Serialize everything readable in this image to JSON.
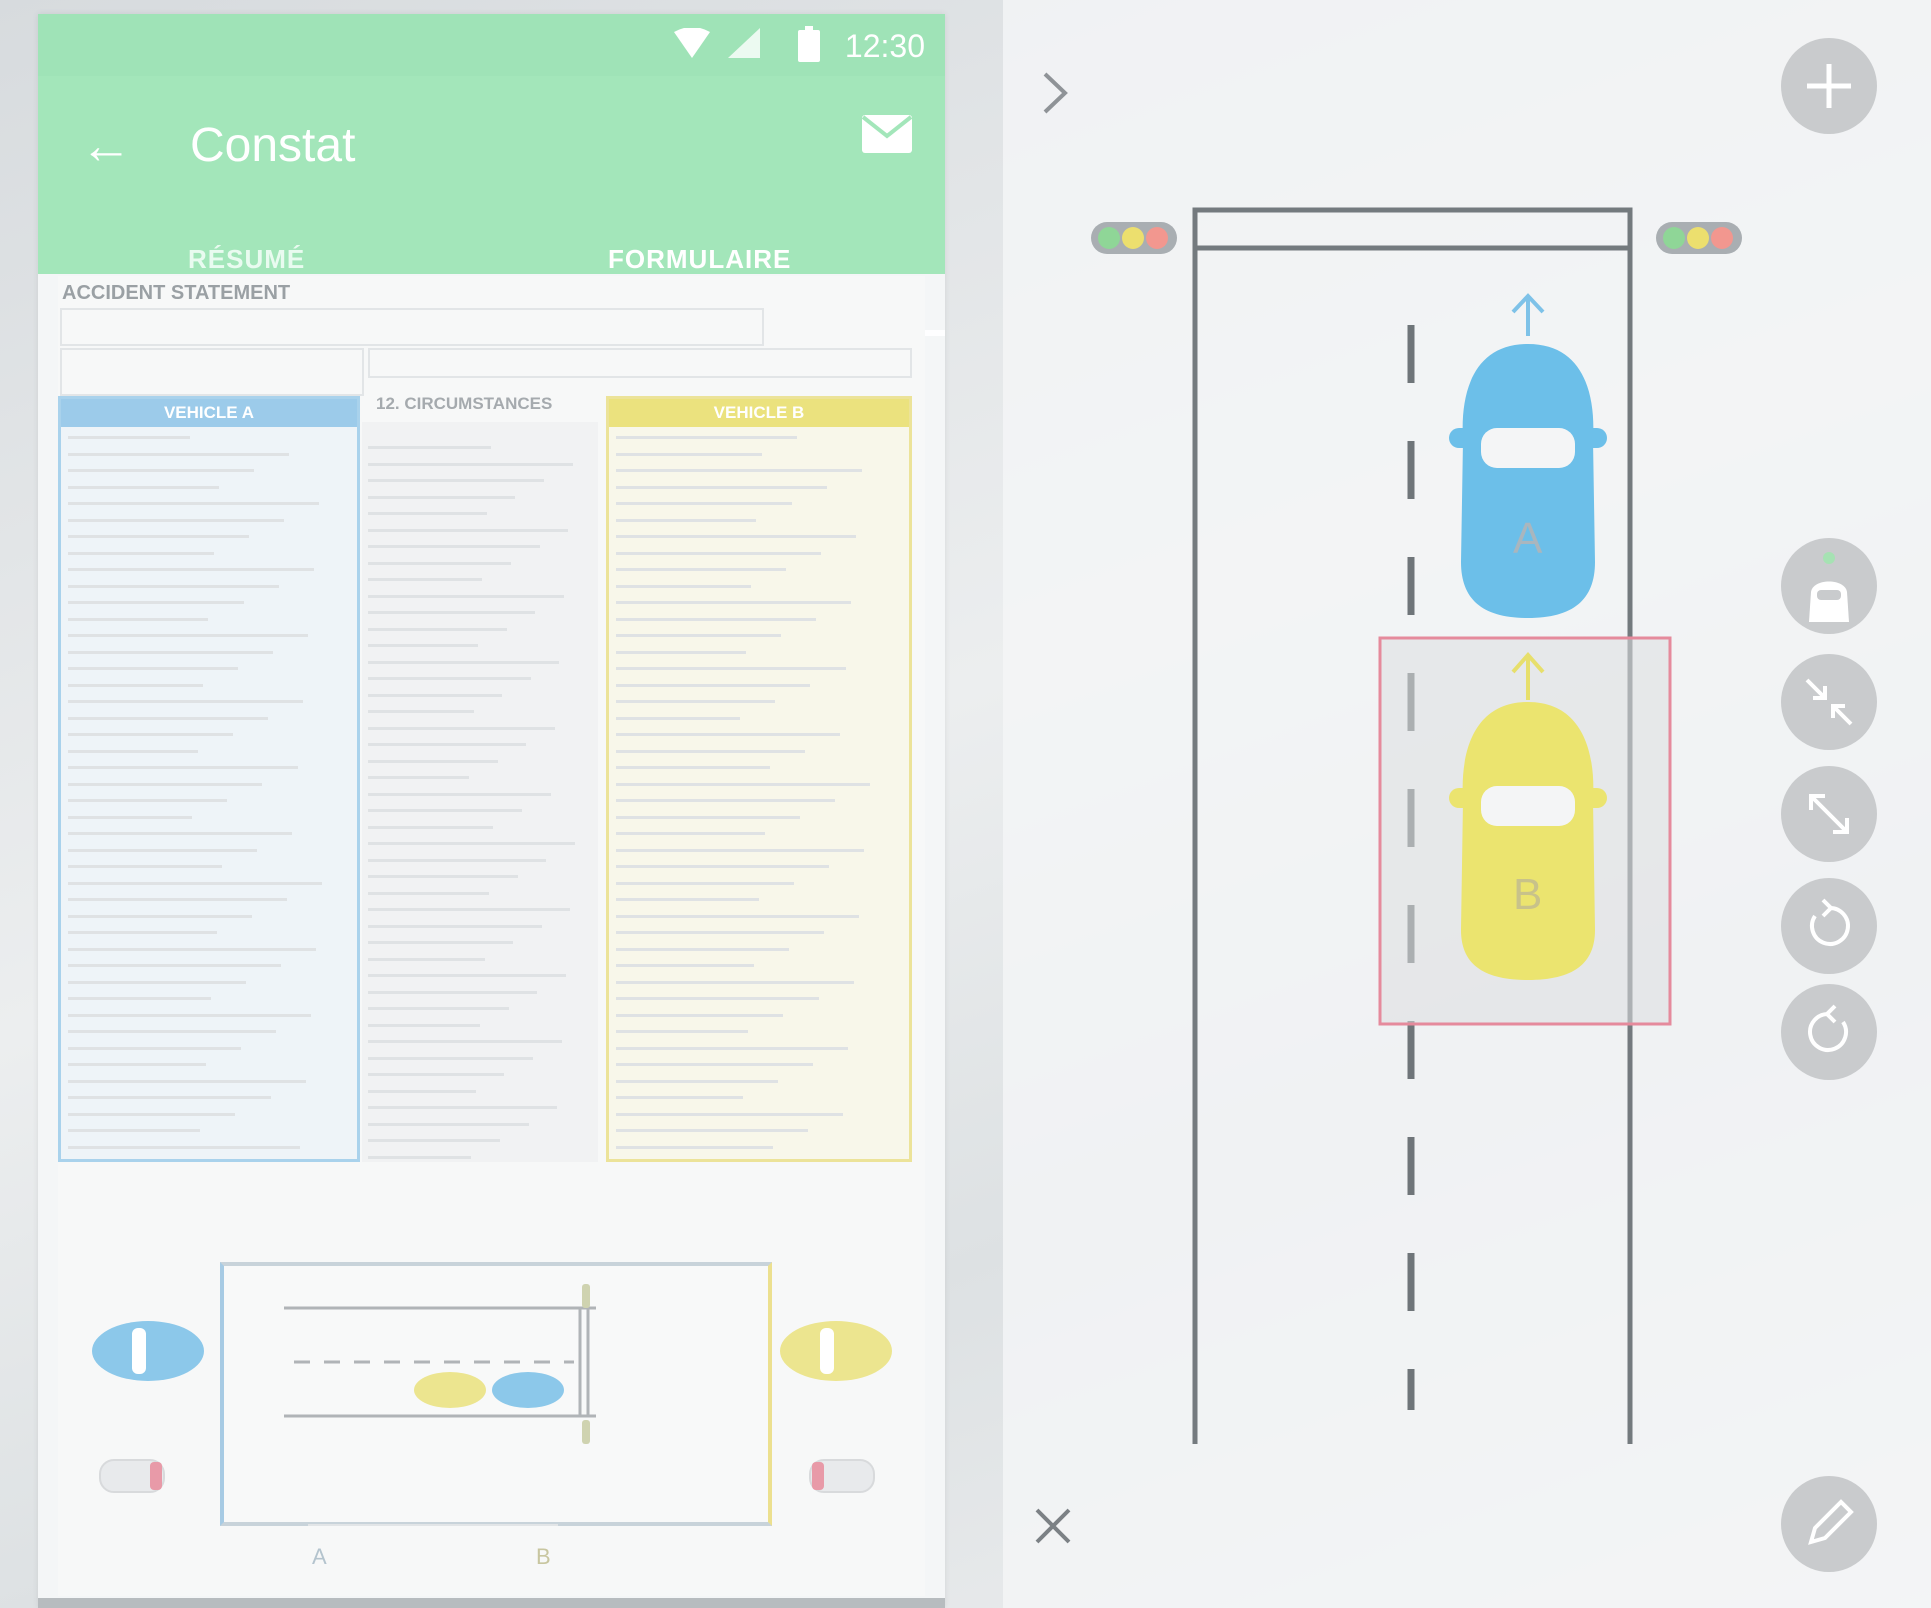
{
  "status_bar": {
    "time": "12:30"
  },
  "app_bar": {
    "title": "Constat",
    "back_icon": "arrow-back-icon",
    "mail_icon": "mail-icon"
  },
  "tabs": [
    {
      "label": "RÉSUMÉ",
      "active": false
    },
    {
      "label": "FORMULAIRE",
      "active": true
    }
  ],
  "form": {
    "title": "ACCIDENT STATEMENT",
    "vehicle_a_header": "VEHICLE A",
    "vehicle_b_header": "VEHICLE B",
    "circumstances_header": "12. CIRCUMSTANCES",
    "vehicle_a_letter": "A",
    "vehicle_b_letter": "B"
  },
  "sketch": {
    "car_a_label": "A",
    "car_b_label": "B",
    "icons": {
      "collapse": "chevron-right-icon",
      "add": "plus-icon",
      "car_tool": "car-icon",
      "shrink": "compress-icon",
      "expand": "expand-icon",
      "rotate_cw": "rotate-clockwise-icon",
      "rotate_ccw": "rotate-counterclockwise-icon",
      "close": "close-icon",
      "edit": "pencil-icon",
      "traffic_light": "traffic-light-icon"
    }
  },
  "colors": {
    "app_green": "#a3e6ba",
    "vehicle_a": "#5cb8e6",
    "vehicle_b": "#e9e46e",
    "selection": "#e58a9c",
    "fab": "#c9cbcd"
  }
}
